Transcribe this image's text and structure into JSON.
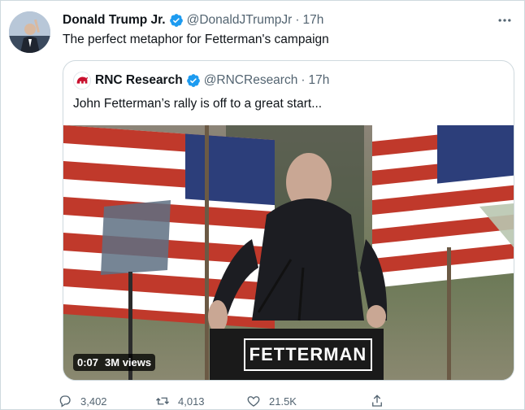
{
  "tweet": {
    "author_name": "Donald Trump Jr.",
    "handle": "@DonaldJTrumpJr",
    "separator": "·",
    "time": "17h",
    "text": "The perfect metaphor for Fetterman's campaign",
    "more_icon": "more-icon",
    "verified_icon": "verified-badge-icon"
  },
  "quoted": {
    "author_name": "RNC Research",
    "handle": "@RNCResearch",
    "separator": "·",
    "time": "17h",
    "text": "John Fetterman’s rally is off to a great start...",
    "media": {
      "podium_sign": "FETTERMAN",
      "duration": "0:07",
      "views": "3M views"
    }
  },
  "actions": {
    "reply_count": "3,402",
    "retweet_count": "4,013",
    "like_count": "21.5K",
    "icons": [
      "reply-icon",
      "retweet-icon",
      "like-icon",
      "share-icon"
    ]
  },
  "colors": {
    "text": "#0f1419",
    "secondary": "#536471",
    "border": "#cfd9de",
    "verified": "#1d9bf0"
  }
}
